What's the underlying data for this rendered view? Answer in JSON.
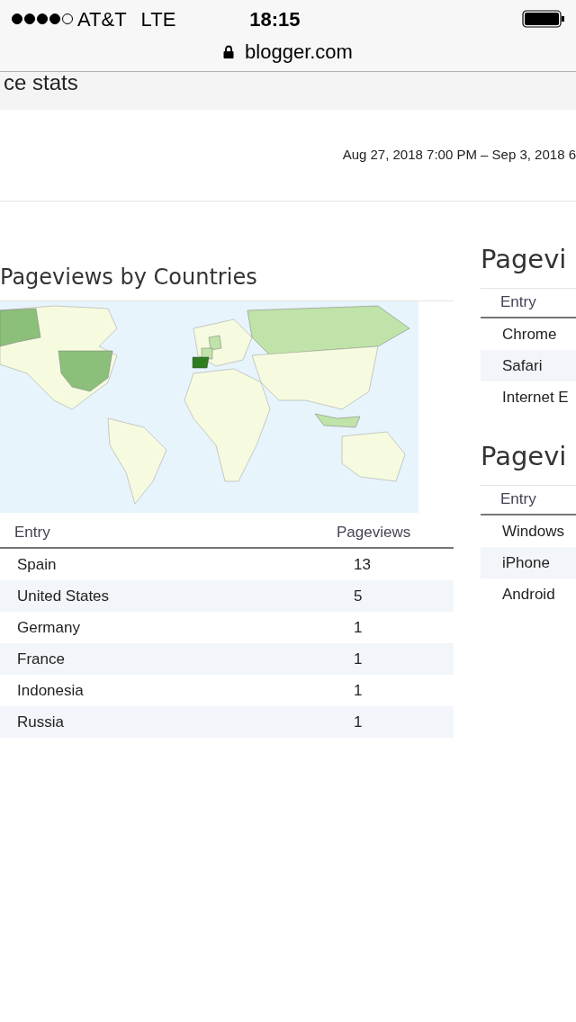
{
  "status_bar": {
    "carrier": "AT&T",
    "network": "LTE",
    "time": "18:15"
  },
  "address_bar": {
    "url": "blogger.com"
  },
  "page_title": "ce stats",
  "date_range": "Aug 27, 2018 7:00 PM – Sep 3, 2018 6",
  "countries": {
    "title": "Pageviews by Countries",
    "columns": [
      "Entry",
      "Pageviews"
    ],
    "rows": [
      [
        "Spain",
        "13"
      ],
      [
        "United States",
        "5"
      ],
      [
        "Germany",
        "1"
      ],
      [
        "France",
        "1"
      ],
      [
        "Indonesia",
        "1"
      ],
      [
        "Russia",
        "1"
      ]
    ]
  },
  "side_panels": [
    {
      "title": "Pagevi",
      "column": "Entry",
      "rows": [
        "Chrome",
        "Safari",
        "Internet E"
      ]
    },
    {
      "title": "Pagevi",
      "column": "Entry",
      "rows": [
        "Windows",
        "iPhone",
        "Android"
      ]
    }
  ]
}
